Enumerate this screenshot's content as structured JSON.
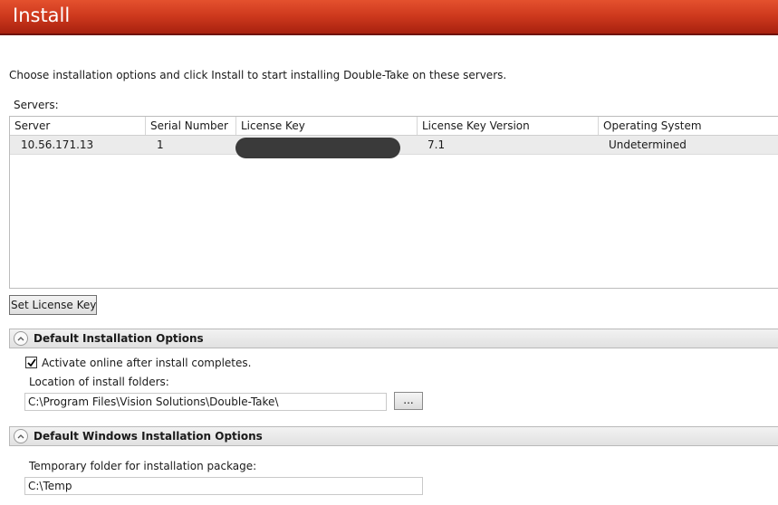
{
  "header": {
    "title": "Install"
  },
  "intro": "Choose installation options and click Install to start installing Double-Take on these servers.",
  "servers": {
    "label": "Servers:",
    "columns": [
      "Server",
      "Serial Number",
      "License Key",
      "License Key Version",
      "Operating System"
    ],
    "rows": [
      {
        "server": "10.56.171.13",
        "serial": "1",
        "license_key": "",
        "version": "7.1",
        "os": "Undetermined"
      }
    ]
  },
  "set_license_button": "Set License Keys...",
  "default_install": {
    "title": "Default Installation Options",
    "activate_label": "Activate online after install completes.",
    "activate_checked": true,
    "location_label": "Location of install folders:",
    "location_value": "C:\\Program Files\\Vision Solutions\\Double-Take\\",
    "browse_label": "..."
  },
  "windows_install": {
    "title": "Default Windows Installation Options",
    "temp_label": "Temporary folder for installation package:",
    "temp_value": "C:\\Temp"
  },
  "colors": {
    "header": "#cf3a1e",
    "row_selected": "#ebebeb"
  }
}
